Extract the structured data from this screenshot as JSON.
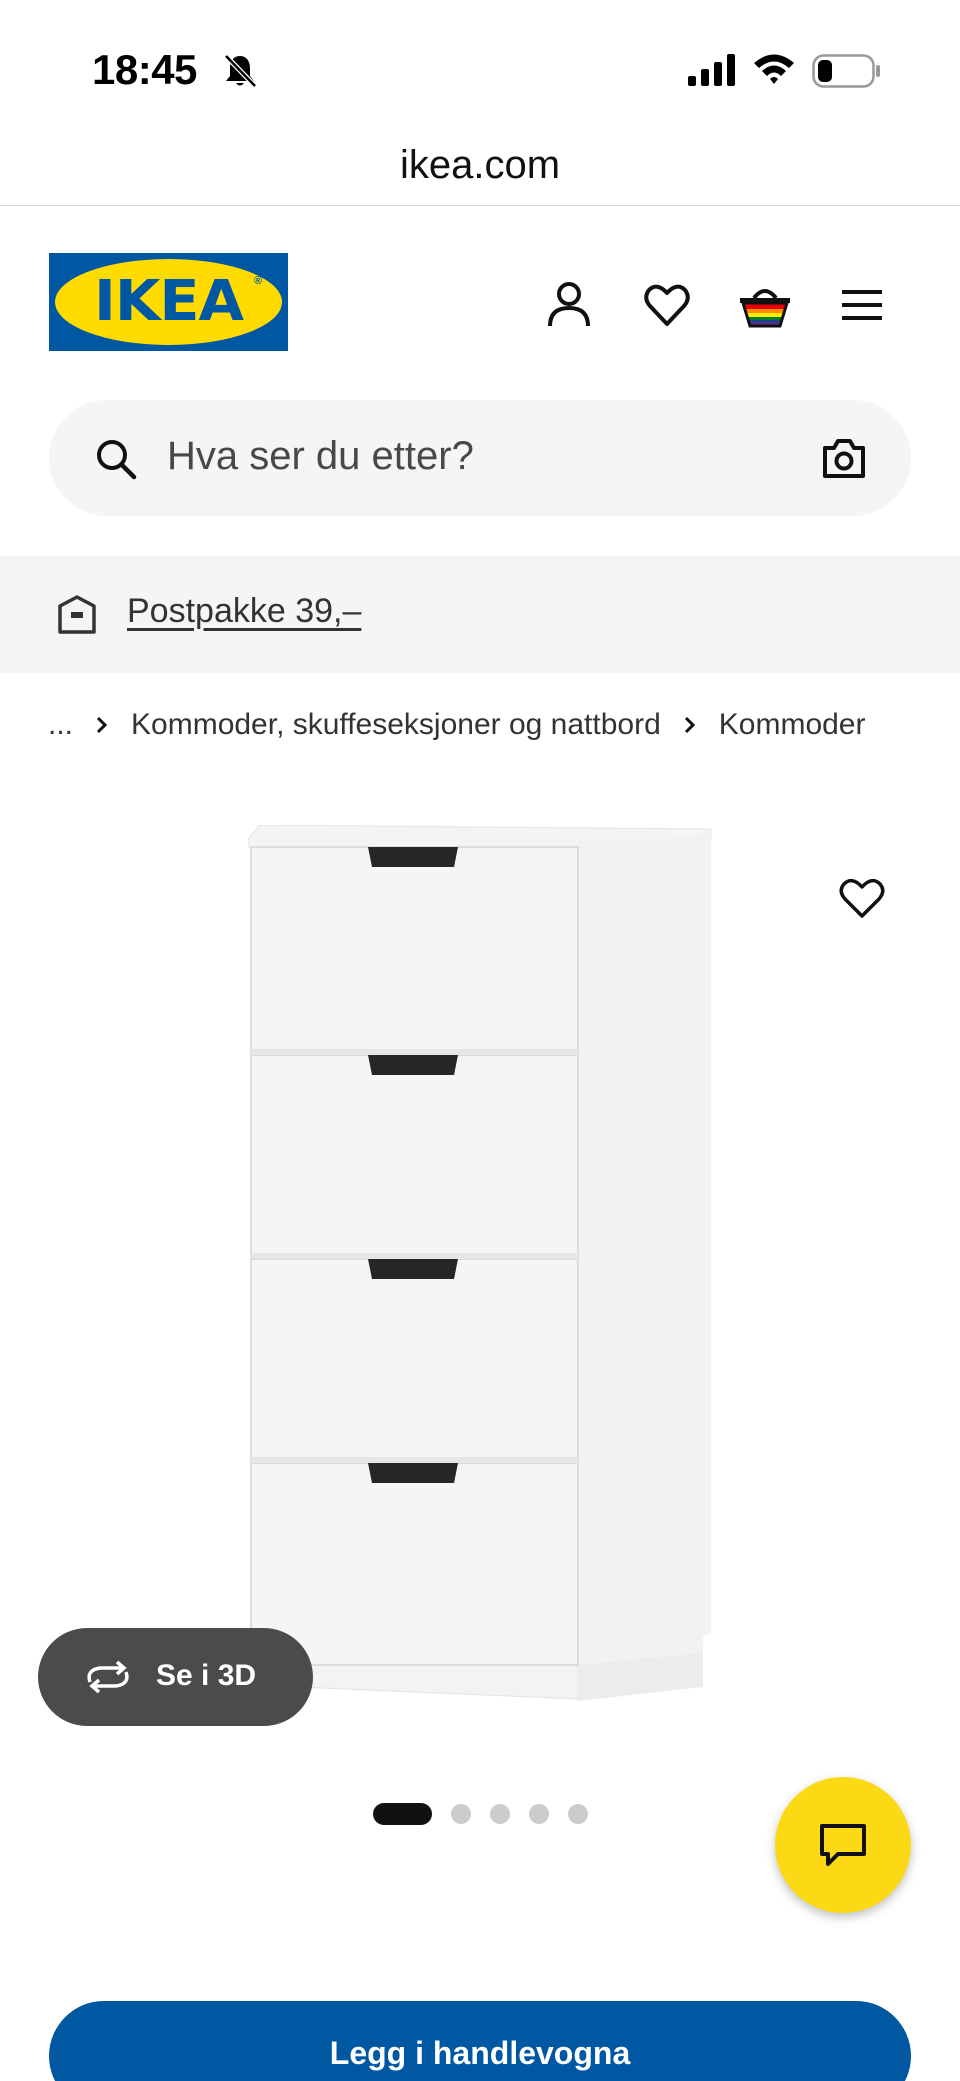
{
  "status_bar": {
    "time": "18:45",
    "icons": [
      "bell-slash-icon",
      "cellular-signal-icon",
      "wifi-icon",
      "battery-icon"
    ]
  },
  "browser": {
    "url": "ikea.com"
  },
  "header": {
    "logo_text": "IKEA",
    "logo_reg": "®",
    "icons": [
      "account-icon",
      "heart-icon",
      "basket-icon",
      "menu-icon"
    ],
    "brand_blue": "#0058a3",
    "brand_yellow": "#ffdb00"
  },
  "search": {
    "placeholder": "Hva ser du etter?",
    "icons": [
      "search-icon",
      "camera-icon"
    ]
  },
  "promo": {
    "text": "Postpakke 39,–",
    "icon": "parcel-icon"
  },
  "breadcrumb": {
    "items": [
      "...",
      "Kommoder, skuffeseksjoner og nattbord",
      "Kommoder"
    ]
  },
  "product": {
    "image": "white-chest-of-drawers",
    "drawer_count": 4,
    "see_3d_label": "Se i 3D",
    "carousel_total": 5,
    "carousel_active": 1
  },
  "actions": {
    "add_to_cart_label": "Legg i handlevogna",
    "chat_color": "#fbd914"
  }
}
